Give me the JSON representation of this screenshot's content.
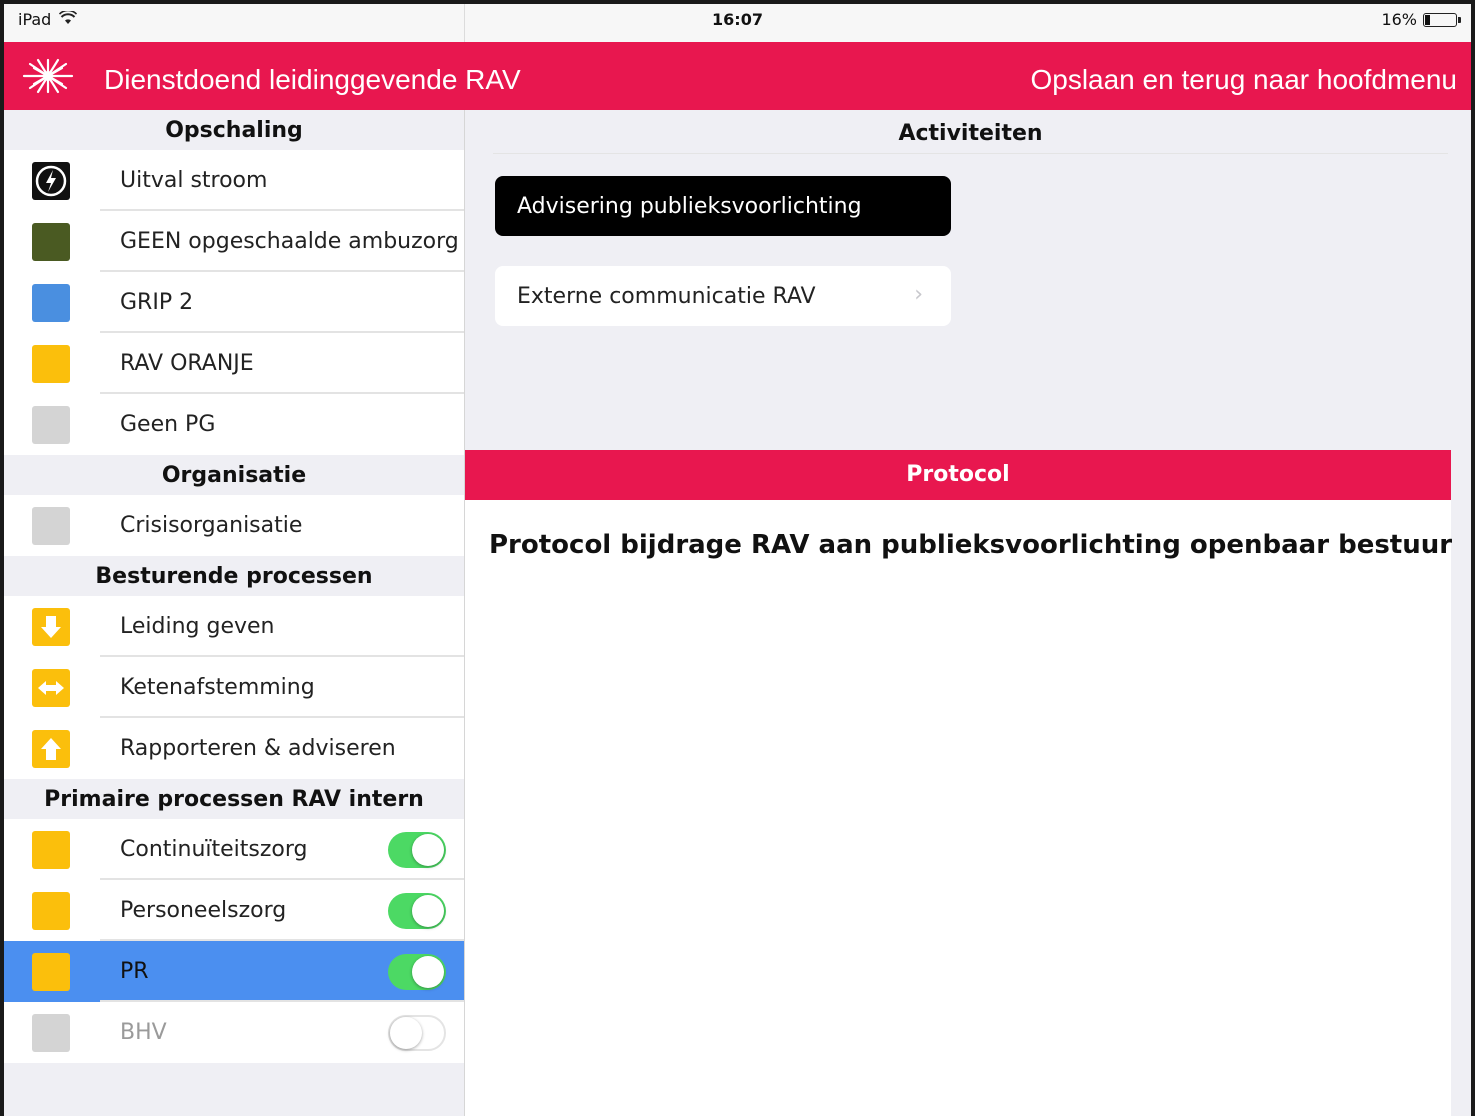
{
  "status_bar": {
    "device": "iPad",
    "time": "16:07",
    "battery": "16%",
    "battery_level": 0.16
  },
  "nav": {
    "title": "Dienstdoend leidinggevende RAV",
    "back_label": "Opslaan en terug naar hoofdmenu",
    "logo_icon": "star-of-life-logo-icon"
  },
  "sidebar": {
    "sections": [
      {
        "title": "Opschaling",
        "items": [
          {
            "label": "Uitval stroom",
            "color": "#111111",
            "icon": "power-outage-icon"
          },
          {
            "label": "GEEN opgeschaalde ambuzorg",
            "color": "#4a5a22"
          },
          {
            "label": "GRIP 2",
            "color": "#4a8fe0"
          },
          {
            "label": "RAV ORANJE",
            "color": "#fbbf0c"
          },
          {
            "label": "Geen PG",
            "color": "#d4d4d4"
          }
        ]
      },
      {
        "title": "Organisatie",
        "items": [
          {
            "label": "Crisisorganisatie",
            "color": "#d4d4d4"
          }
        ]
      },
      {
        "title": "Besturende processen",
        "items": [
          {
            "label": "Leiding geven",
            "color": "#fbbf0c",
            "icon": "arrow-down-icon"
          },
          {
            "label": "Ketenafstemming",
            "color": "#fbbf0c",
            "icon": "arrows-left-right-icon"
          },
          {
            "label": "Rapporteren & adviseren",
            "color": "#fbbf0c",
            "icon": "arrow-up-icon"
          }
        ]
      },
      {
        "title": "Primaire processen RAV intern",
        "items": [
          {
            "label": "Continuïteitszorg",
            "color": "#fbbf0c",
            "toggle": true
          },
          {
            "label": "Personeelszorg",
            "color": "#fbbf0c",
            "toggle": true
          },
          {
            "label": "PR",
            "color": "#fbbf0c",
            "toggle": true,
            "selected": true
          },
          {
            "label": "BHV",
            "color": "#d4d4d4",
            "toggle": false,
            "disabled": true
          }
        ]
      }
    ]
  },
  "main": {
    "activities_header": "Activiteiten",
    "activities": [
      {
        "label": "Advisering publieksvoorlichting",
        "selected": true
      },
      {
        "label": "Externe communicatie RAV",
        "selected": false
      }
    ],
    "protocol_header": "Protocol",
    "protocol_text": "Protocol bijdrage RAV aan publieksvoorlichting openbaar bestuur"
  }
}
